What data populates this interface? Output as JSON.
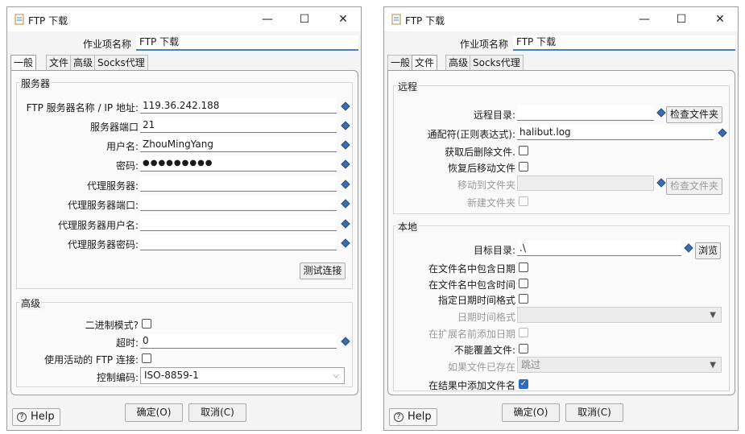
{
  "left": {
    "title": "FTP 下载",
    "jobname_label": "作业项名称",
    "jobname_value": "FTP 下载",
    "tabs": [
      "一般",
      "文件",
      "高级",
      "Socks代理"
    ],
    "server_group": "服务器",
    "fields": [
      {
        "label": "FTP 服务器名称 / IP 地址:",
        "value": "119.36.242.188"
      },
      {
        "label": "服务器端口",
        "value": "21"
      },
      {
        "label": "用户名:",
        "value": "ZhouMingYang"
      },
      {
        "label": "密码:",
        "value": "●●●●●●●●●"
      },
      {
        "label": "代理服务器:",
        "value": ""
      },
      {
        "label": "代理服务器端口:",
        "value": ""
      },
      {
        "label": "代理服务器用户名:",
        "value": ""
      },
      {
        "label": "代理服务器密码:",
        "value": ""
      }
    ],
    "test_button": "测试连接",
    "advanced_group": "高级",
    "binary_label": "二进制模式?",
    "timeout_label": "超时:",
    "timeout_value": "0",
    "active_label": "使用活动的 FTP 连接:",
    "encoding_label": "控制编码:",
    "encoding_value": "ISO-8859-1",
    "help": "Help",
    "ok": "确定(O)",
    "cancel": "取消(C)"
  },
  "right": {
    "title": "FTP 下载",
    "jobname_label": "作业项名称",
    "jobname_value": "FTP 下载",
    "tabs": [
      "一般",
      "文件",
      "高级",
      "Socks代理"
    ],
    "remote_group": "远程",
    "remote_dir_label": "远程目录:",
    "remote_dir_value": "",
    "browse_remote": "检查文件夹",
    "wildcard_label": "通配符(正则表达式):",
    "wildcard_value": "halibut.log",
    "delete_after_label": "获取后删除文件.",
    "move_after_label": "恢复后移动文件",
    "move_to_label": "移动到文件夹",
    "browse_move": "检查文件夹",
    "create_folder_label": "新建文件夹",
    "local_group": "本地",
    "target_dir_label": "目标目录:",
    "target_dir_value": ".\\",
    "browse_local": "浏览",
    "include_date_label": "在文件名中包含日期",
    "include_time_label": "在文件名中包含时间",
    "specify_format_label": "指定日期时间格式",
    "datetime_format_label": "日期时间格式",
    "add_date_before_ext_label": "在扩展名前添加日期",
    "no_overwrite_label": "不能覆盖文件:",
    "if_exists_label": "如果文件已存在",
    "if_exists_value": "跳过",
    "add_to_result_label": "在结果中添加文件名",
    "help": "Help",
    "ok": "确定(O)",
    "cancel": "取消(C)"
  },
  "colors": {
    "accent": "#4a7fc1",
    "check": "#2d6cc0"
  }
}
